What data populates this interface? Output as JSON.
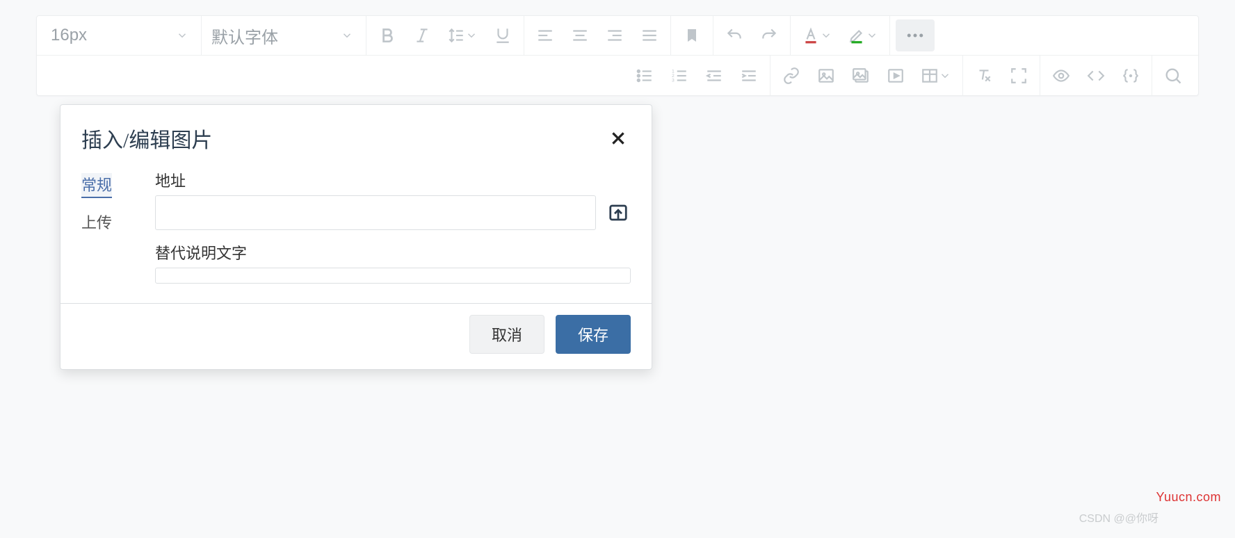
{
  "toolbar": {
    "font_size": "16px",
    "font_family": "默认字体"
  },
  "dialog": {
    "title": "插入/编辑图片",
    "tabs": {
      "general": "常规",
      "upload": "上传"
    },
    "labels": {
      "url": "地址",
      "alt": "替代说明文字"
    },
    "values": {
      "url": "",
      "alt": ""
    },
    "actions": {
      "cancel": "取消",
      "save": "保存"
    }
  },
  "watermarks": {
    "site": "Yuucn.com",
    "credit": "CSDN @@你呀"
  }
}
